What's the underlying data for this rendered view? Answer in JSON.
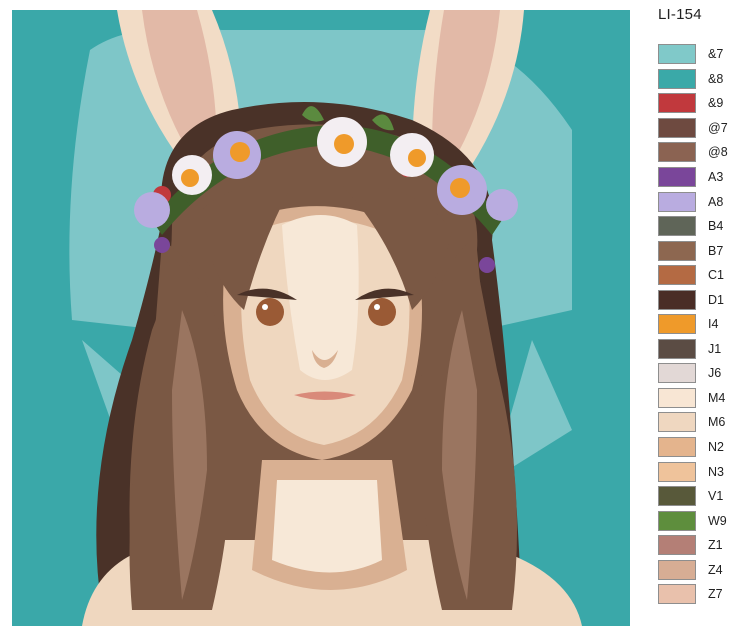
{
  "title": "LI-154",
  "scene": {
    "bg_teal": "#3aa8a9",
    "bg_light": "#7ec6c8",
    "hair": "#7a5844",
    "hair_dark": "#4a3228",
    "hair_light": "#9a7560",
    "skin": "#efd7bf",
    "skin_light": "#f7e8d7",
    "skin_shadow": "#d9b092",
    "skin_deep": "#c2927a",
    "ear_outer": "#f2dcc6",
    "ear_inner": "#e2b9a7",
    "eye": "#9a5a35",
    "lips": "#d98a7a",
    "flower_white": "#f3eef2",
    "flower_lavender": "#b9ace0",
    "flower_center": "#ef9a2a",
    "leaf": "#5b8a3f",
    "leaf_dark": "#3f5f2a",
    "berry": "#c1393d",
    "purple": "#7a469a"
  },
  "palette": [
    {
      "code": "&7",
      "color": "#80c9c9"
    },
    {
      "code": "&8",
      "color": "#3aa9a8"
    },
    {
      "code": "&9",
      "color": "#c1393d"
    },
    {
      "code": "@7",
      "color": "#6e4a40"
    },
    {
      "code": "@8",
      "color": "#8b6352"
    },
    {
      "code": "A3",
      "color": "#7a469a"
    },
    {
      "code": "A8",
      "color": "#b9ace0"
    },
    {
      "code": "B4",
      "color": "#5f6558"
    },
    {
      "code": "B7",
      "color": "#8d6750"
    },
    {
      "code": "C1",
      "color": "#b46a43"
    },
    {
      "code": "D1",
      "color": "#4a2d26"
    },
    {
      "code": "I4",
      "color": "#ef9a2a"
    },
    {
      "code": "J1",
      "color": "#5b4c44"
    },
    {
      "code": "J6",
      "color": "#e2d8d6"
    },
    {
      "code": "M4",
      "color": "#f8e6d4"
    },
    {
      "code": "M6",
      "color": "#efd7c0"
    },
    {
      "code": "N2",
      "color": "#e4b48d"
    },
    {
      "code": "N3",
      "color": "#efc39b"
    },
    {
      "code": "V1",
      "color": "#58593a"
    },
    {
      "code": "W9",
      "color": "#5e8e3d"
    },
    {
      "code": "Z1",
      "color": "#b47f76"
    },
    {
      "code": "Z4",
      "color": "#d7ad94"
    },
    {
      "code": "Z7",
      "color": "#e9c1ac"
    }
  ]
}
